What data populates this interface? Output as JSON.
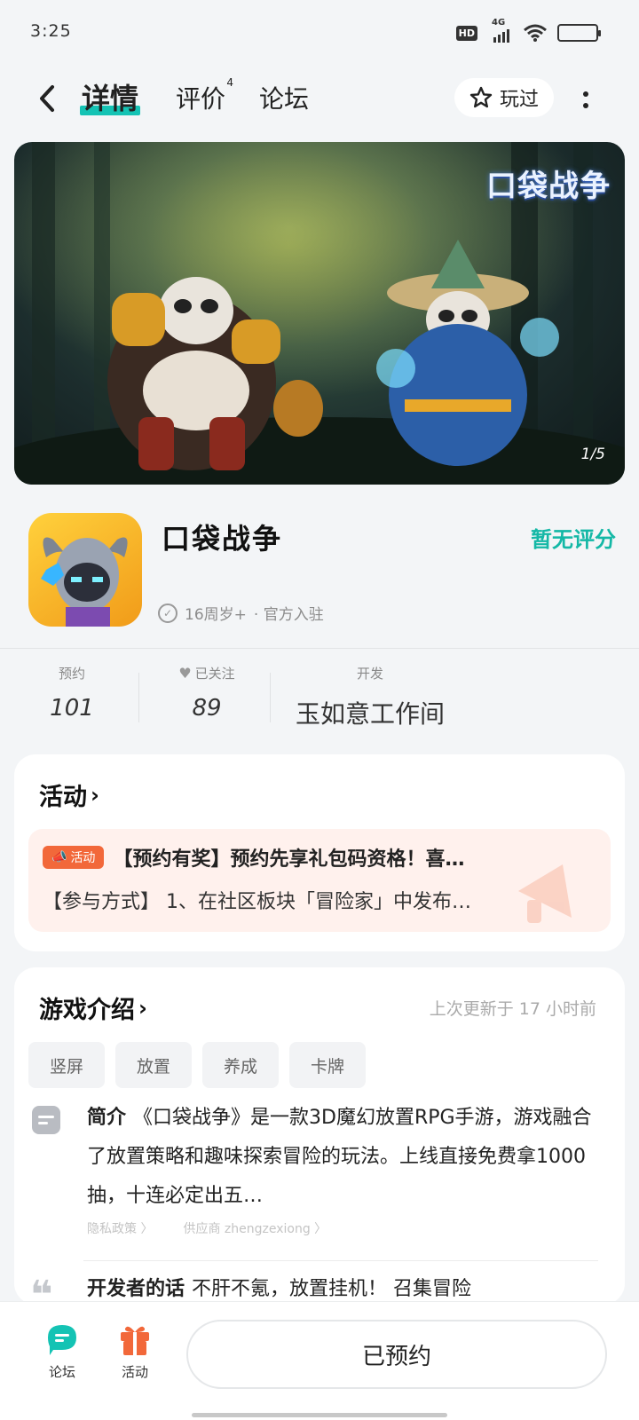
{
  "status": {
    "time": "3:25",
    "hd": "HD",
    "network": "4G"
  },
  "nav": {
    "tabs": [
      {
        "label": "详情"
      },
      {
        "label": "评价",
        "badge": "4"
      },
      {
        "label": "论坛"
      }
    ],
    "played_label": "玩过"
  },
  "banner": {
    "logo_text": "口袋战争",
    "counter": "1/5"
  },
  "game": {
    "name": "口袋战争",
    "rating": "暂无评分",
    "age_rating": "16周岁+",
    "official": "· 官方入驻"
  },
  "stats": [
    {
      "label": "预约",
      "value": "101"
    },
    {
      "label": "已关注",
      "value": "89"
    },
    {
      "label": "开发",
      "value": "玉如意工作间"
    }
  ],
  "activity": {
    "title": "活动",
    "tag": "活动",
    "line1": "【预约有奖】预约先享礼包码资格！喜…",
    "line2": "【参与方式】 1、在社区板块「冒险家」中发布…"
  },
  "intro": {
    "title": "游戏介绍",
    "updated": "上次更新于 17 小时前",
    "tags": [
      "竖屏",
      "放置",
      "养成",
      "卡牌"
    ],
    "label": "简介",
    "text": "《口袋战争》是一款3D魔幻放置RPG手游，游戏融合了放置策略和趣味探索冒险的玩法。上线直接免费拿1000抽，十连必定出五…",
    "privacy": "隐私政策 〉",
    "supplier": "供应商 zhengzexiong 〉",
    "dev_label": "开发者的话",
    "dev_text": "不肝不氪，放置挂机！ 召集冒险"
  },
  "bottom": {
    "forum": "论坛",
    "activity": "活动",
    "reserve": "已预约"
  },
  "colors": {
    "accent": "#14c3b4",
    "activity": "#f2683a",
    "rating": "#14b8a6"
  }
}
